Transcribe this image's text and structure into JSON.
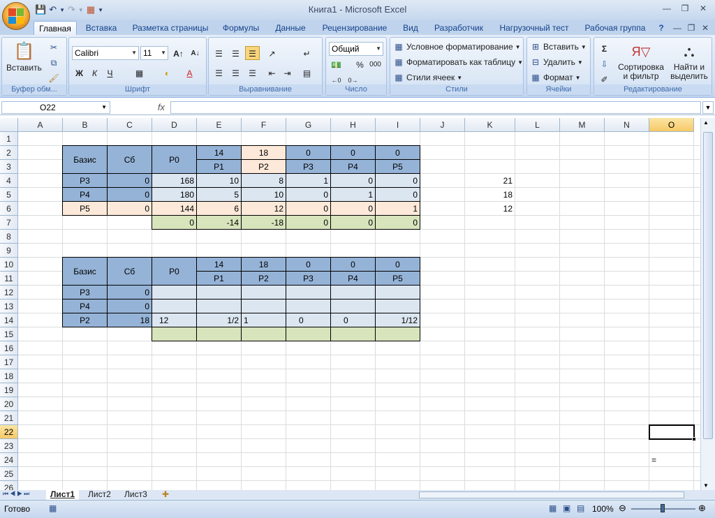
{
  "window": {
    "title": "Книга1 - Microsoft Excel"
  },
  "tabs": [
    "Главная",
    "Вставка",
    "Разметка страницы",
    "Формулы",
    "Данные",
    "Рецензирование",
    "Вид",
    "Разработчик",
    "Нагрузочный тест",
    "Рабочая группа"
  ],
  "ribbon": {
    "clipboard": {
      "paste": "Вставить",
      "label": "Буфер обм..."
    },
    "font": {
      "name": "Calibri",
      "size": "11",
      "bold": "Ж",
      "italic": "К",
      "underline": "Ч",
      "label": "Шрифт"
    },
    "alignment": {
      "label": "Выравнивание"
    },
    "number": {
      "format": "Общий",
      "percent": "%",
      "thousands": "000",
      "label": "Число"
    },
    "styles": {
      "conditional": "Условное форматирование",
      "as_table": "Форматировать как таблицу",
      "cell_styles": "Стили ячеек",
      "label": "Стили"
    },
    "cells": {
      "insert": "Вставить",
      "delete": "Удалить",
      "format": "Формат",
      "label": "Ячейки"
    },
    "editing": {
      "sort": "Сортировка и фильтр",
      "sort_1": "Сортировка",
      "sort_2": "и фильтр",
      "find_1": "Найти и",
      "find_2": "выделить",
      "label": "Редактирование"
    }
  },
  "formula_bar": {
    "name_box": "O22",
    "fx": "fx",
    "formula": ""
  },
  "grid": {
    "columns": [
      "A",
      "B",
      "C",
      "D",
      "E",
      "F",
      "G",
      "H",
      "I",
      "J",
      "K",
      "L",
      "M",
      "N",
      "O"
    ],
    "rows": [
      "1",
      "2",
      "3",
      "4",
      "5",
      "6",
      "7",
      "8",
      "9",
      "10",
      "11",
      "12",
      "13",
      "14",
      "15",
      "16",
      "17",
      "18",
      "19",
      "20",
      "21",
      "22",
      "23",
      "24",
      "25",
      "26"
    ],
    "selected_cell": "O22",
    "cells": [
      [
        "B2",
        "Базис"
      ],
      [
        "C2",
        "Сб"
      ],
      [
        "D2",
        "P0"
      ],
      [
        "E2",
        "14"
      ],
      [
        "F2",
        "18"
      ],
      [
        "G2",
        "0"
      ],
      [
        "H2",
        "0"
      ],
      [
        "I2",
        "0"
      ],
      [
        "E3",
        "P1"
      ],
      [
        "F3",
        "P2"
      ],
      [
        "G3",
        "P3"
      ],
      [
        "H3",
        "P4"
      ],
      [
        "I3",
        "P5"
      ],
      [
        "B4",
        "P3"
      ],
      [
        "C4",
        "0"
      ],
      [
        "D4",
        "168"
      ],
      [
        "E4",
        "10"
      ],
      [
        "F4",
        "8"
      ],
      [
        "G4",
        "1"
      ],
      [
        "H4",
        "0"
      ],
      [
        "I4",
        "0"
      ],
      [
        "K4",
        "21"
      ],
      [
        "B5",
        "P4"
      ],
      [
        "C5",
        "0"
      ],
      [
        "D5",
        "180"
      ],
      [
        "E5",
        "5"
      ],
      [
        "F5",
        "10"
      ],
      [
        "G5",
        "0"
      ],
      [
        "H5",
        "1"
      ],
      [
        "I5",
        "0"
      ],
      [
        "K5",
        "18"
      ],
      [
        "B6",
        "P5"
      ],
      [
        "C6",
        "0"
      ],
      [
        "D6",
        "144"
      ],
      [
        "E6",
        "6"
      ],
      [
        "F6",
        "12"
      ],
      [
        "G6",
        "0"
      ],
      [
        "H6",
        "0"
      ],
      [
        "I6",
        "1"
      ],
      [
        "K6",
        "12"
      ],
      [
        "D7",
        "0"
      ],
      [
        "E7",
        "-14"
      ],
      [
        "F7",
        "-18"
      ],
      [
        "G7",
        "0"
      ],
      [
        "H7",
        "0"
      ],
      [
        "I7",
        "0"
      ],
      [
        "B10",
        "Базис"
      ],
      [
        "C10",
        "Сб"
      ],
      [
        "D10",
        "P0"
      ],
      [
        "E10",
        "14"
      ],
      [
        "F10",
        "18"
      ],
      [
        "G10",
        "0"
      ],
      [
        "H10",
        "0"
      ],
      [
        "I10",
        "0"
      ],
      [
        "E11",
        "P1"
      ],
      [
        "F11",
        "P2"
      ],
      [
        "G11",
        "P3"
      ],
      [
        "H11",
        "P4"
      ],
      [
        "I11",
        "P5"
      ],
      [
        "B12",
        "P3"
      ],
      [
        "C12",
        "0"
      ],
      [
        "B13",
        "P4"
      ],
      [
        "C13",
        "0"
      ],
      [
        "B14",
        "P2"
      ],
      [
        "C14",
        "18"
      ],
      [
        "D14",
        "12"
      ],
      [
        "E14",
        "1/2"
      ],
      [
        "F14",
        "1"
      ],
      [
        "G14",
        "0"
      ],
      [
        "H14",
        "0"
      ],
      [
        "I14",
        "1/12"
      ],
      [
        "O24",
        "="
      ]
    ]
  },
  "sheets": [
    "Лист1",
    "Лист2",
    "Лист3"
  ],
  "status": {
    "ready": "Готово",
    "zoom": "100%"
  },
  "colors": {
    "header_blue": "#95b3d7",
    "light_blue": "#dce6f1",
    "peach": "#fde9d9",
    "green": "#d7e4bc"
  }
}
